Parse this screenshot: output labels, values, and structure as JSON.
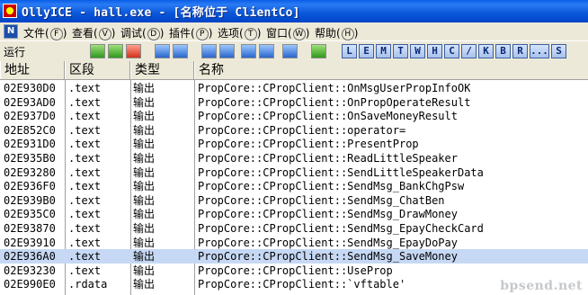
{
  "window": {
    "title": "OllyICE - hall.exe - [名称位于 ClientCo]"
  },
  "menubar": {
    "sys_icon_label": "N",
    "items": [
      {
        "label": "文件",
        "key": "F"
      },
      {
        "label": "查看",
        "key": "V"
      },
      {
        "label": "调试",
        "key": "D"
      },
      {
        "label": "插件",
        "key": "P"
      },
      {
        "label": "选项",
        "key": "T"
      },
      {
        "label": "窗口",
        "key": "W"
      },
      {
        "label": "帮助",
        "key": "H"
      }
    ]
  },
  "toolbar": {
    "status": "运行",
    "letters": [
      "L",
      "E",
      "M",
      "T",
      "W",
      "H",
      "C",
      "/",
      "K",
      "B",
      "R",
      "...",
      "S"
    ]
  },
  "table": {
    "columns": [
      "地址",
      "区段",
      "类型",
      "名称"
    ],
    "rows": [
      {
        "address": "02E930D0",
        "section": ".text",
        "type": "输出",
        "name": "PropCore::CPropClient::OnMsgUserPropInfoOK"
      },
      {
        "address": "02E93AD0",
        "section": ".text",
        "type": "输出",
        "name": "PropCore::CPropClient::OnPropOperateResult"
      },
      {
        "address": "02E937D0",
        "section": ".text",
        "type": "输出",
        "name": "PropCore::CPropClient::OnSaveMoneyResult"
      },
      {
        "address": "02E852C0",
        "section": ".text",
        "type": "输出",
        "name": "PropCore::CPropClient::operator="
      },
      {
        "address": "02E931D0",
        "section": ".text",
        "type": "输出",
        "name": "PropCore::CPropClient::PresentProp"
      },
      {
        "address": "02E935B0",
        "section": ".text",
        "type": "输出",
        "name": "PropCore::CPropClient::ReadLittleSpeaker"
      },
      {
        "address": "02E93280",
        "section": ".text",
        "type": "输出",
        "name": "PropCore::CPropClient::SendLittleSpeakerData"
      },
      {
        "address": "02E936F0",
        "section": ".text",
        "type": "输出",
        "name": "PropCore::CPropClient::SendMsg_BankChgPsw"
      },
      {
        "address": "02E939B0",
        "section": ".text",
        "type": "输出",
        "name": "PropCore::CPropClient::SendMsg_ChatBen"
      },
      {
        "address": "02E935C0",
        "section": ".text",
        "type": "输出",
        "name": "PropCore::CPropClient::SendMsg_DrawMoney"
      },
      {
        "address": "02E93870",
        "section": ".text",
        "type": "输出",
        "name": "PropCore::CPropClient::SendMsg_EpayCheckCard"
      },
      {
        "address": "02E93910",
        "section": ".text",
        "type": "输出",
        "name": "PropCore::CPropClient::SendMsg_EpayDoPay"
      },
      {
        "address": "02E936A0",
        "section": ".text",
        "type": "输出",
        "name": "PropCore::CPropClient::SendMsg_SaveMoney",
        "selected": true
      },
      {
        "address": "02E93230",
        "section": ".text",
        "type": "输出",
        "name": "PropCore::CPropClient::UseProp"
      },
      {
        "address": "02E990E0",
        "section": ".rdata",
        "type": "输出",
        "name": "PropCore::CPropClient::`vftable'"
      }
    ]
  },
  "watermark": "bpsend.net"
}
